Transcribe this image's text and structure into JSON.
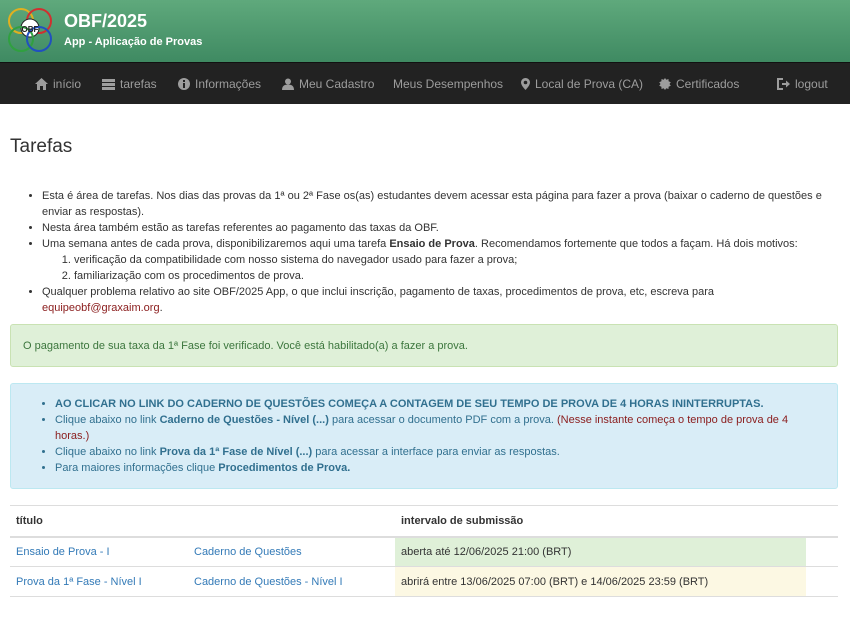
{
  "header": {
    "title": "OBF/2025",
    "subtitle": "App - Aplicação de Provas",
    "logo_text": "OBF"
  },
  "nav": {
    "items": [
      {
        "label": "início",
        "icon": "home-icon"
      },
      {
        "label": "tarefas",
        "icon": "list-icon"
      },
      {
        "label": "Informações",
        "icon": "info-icon"
      },
      {
        "label": "Meu Cadastro",
        "icon": "user-icon"
      },
      {
        "label": "Meus Desempenhos",
        "icon": ""
      },
      {
        "label": "Local de Prova (CA)",
        "icon": "map-marker-icon"
      },
      {
        "label": "Certificados",
        "icon": "certificate-icon"
      },
      {
        "label": "logout",
        "icon": "logout-icon"
      }
    ]
  },
  "page": {
    "title": "Tarefas"
  },
  "intro": {
    "bullet1": "Esta é área de tarefas. Nos dias das provas da 1ª ou 2ª Fase os(as) estudantes devem acessar esta página para fazer a prova (baixar o caderno de questões e enviar as respostas).",
    "bullet2": "Nesta área também estão as tarefas referentes ao pagamento das taxas da OBF.",
    "bullet3_pre": "Uma semana antes de cada prova, disponibilizaremos aqui uma tarefa ",
    "bullet3_bold": "Ensaio de Prova",
    "bullet3_post": ". Recomendamos fortemente que todos a façam. Há dois motivos:",
    "reason1": "verificação da compatibilidade com nosso sistema do navegador usado para fazer a prova;",
    "reason2": "familiarização com os procedimentos de prova.",
    "bullet4": "Qualquer problema relativo ao site OBF/2025 App, o que inclui inscrição, pagamento de taxas, procedimentos de prova, etc, escreva para",
    "email": "equipeobf@graxaim.org",
    "email_suffix": "."
  },
  "alert_success": {
    "text": "O pagamento de sua taxa da 1ª Fase foi verificado. Você está habilitado(a) a fazer a prova."
  },
  "alert_info": {
    "line1": "AO CLICAR NO LINK DO CADERNO DE QUESTÕES COMEÇA A CONTAGEM DE SEU TEMPO DE PROVA DE 4 HORAS ININTERRUPTAS.",
    "line2_pre": "Clique abaixo no link ",
    "line2_bold": "Caderno de Questões - Nível (...)",
    "line2_post": " para acessar o documento PDF com a prova. ",
    "line2_warn": "(Nesse instante começa o tempo de prova de 4 horas.)",
    "line3_pre": "Clique abaixo no link ",
    "line3_bold": "Prova da 1ª Fase de Nível (...)",
    "line3_post": " para acessar a interface para enviar as respostas.",
    "line4_pre": "Para maiores informações clique ",
    "line4_bold": "Procedimentos de Prova."
  },
  "table": {
    "headers": [
      "título",
      "",
      "intervalo de submissão"
    ],
    "rows": [
      {
        "title": "Ensaio de Prova - I",
        "doc": "Caderno de Questões",
        "interval": "aberta até 12/06/2025 21:00 (BRT)"
      },
      {
        "title": "Prova da 1ª Fase - Nível I",
        "doc": "Caderno de Questões - Nível I",
        "interval": "abrirá entre 13/06/2025 07:00 (BRT) e 14/06/2025 23:59 (BRT)"
      }
    ]
  },
  "colors": {
    "header_green": "#4f9a70",
    "navbar": "#222222",
    "success_bg": "#dff0d8",
    "info_bg": "#d9edf7",
    "warning_bg": "#fcf8e3",
    "link": "#337ab7"
  }
}
